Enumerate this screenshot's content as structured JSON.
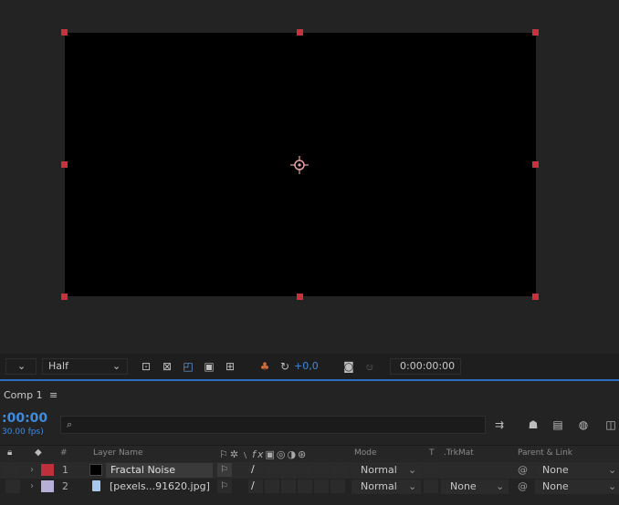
{
  "viewer": {
    "resolution": "Half",
    "exposure": "+0,0",
    "timecode": "0:00:00:00"
  },
  "panel": {
    "title": "Comp 1",
    "menu_icon": "≡",
    "current_time": ":00:00",
    "fps": "30.00 fps)",
    "search_placeholder": "⌕"
  },
  "columns": {
    "hash": "#",
    "layer_name": "Layer Name",
    "mode": "Mode",
    "t": "T",
    "trkmat": ".TrkMat",
    "parent": "Parent & Link"
  },
  "layers": [
    {
      "num": "1",
      "name": "Fractal Noise",
      "label_color": "#c0303a",
      "mode": "Normal",
      "trkmat": "",
      "parent": "None"
    },
    {
      "num": "2",
      "name": "[pexels...91620.jpg]",
      "label_color": "#b6b0d8",
      "mode": "Normal",
      "trkmat": "None",
      "parent": "None"
    }
  ],
  "colors": {
    "accent": "#2c6fc2",
    "handle": "#c8323a"
  }
}
